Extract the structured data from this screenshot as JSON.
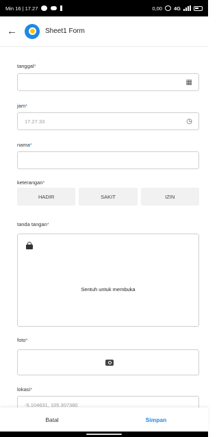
{
  "status_bar": {
    "time": "Min 16 | 17.27",
    "data_speed": "0,00",
    "network": "4G"
  },
  "app_bar": {
    "title": "Sheet1 Form"
  },
  "form": {
    "tanggal": {
      "label": "tanggal",
      "required_mark": "*",
      "value": ""
    },
    "jam": {
      "label": "jam",
      "required_mark": "*",
      "value": "17.27.33"
    },
    "nama": {
      "label": "nama",
      "required_mark": "*",
      "value": ""
    },
    "keterangan": {
      "label": "keterangan",
      "required_mark": "*",
      "options": [
        "HADIR",
        "SAKIT",
        "IZIN"
      ]
    },
    "tanda_tangan": {
      "label": "tanda tangan",
      "required_mark": "*",
      "hint": "Sentuh untuk membuka"
    },
    "foto": {
      "label": "foto",
      "required_mark": "*"
    },
    "lokasi": {
      "label": "lokasi",
      "required_mark": "*",
      "value": "-5.104631, 105.307380"
    }
  },
  "footer": {
    "cancel_label": "Batal",
    "save_label": "Simpan"
  },
  "colors": {
    "accent": "#1e88e5",
    "border": "#cfcfcf",
    "segment_bg": "#f1f1f1"
  },
  "icons": [
    "message-icon",
    "calendar-icon",
    "clock-icon",
    "lock-icon",
    "camera-icon",
    "back-arrow-icon"
  ]
}
